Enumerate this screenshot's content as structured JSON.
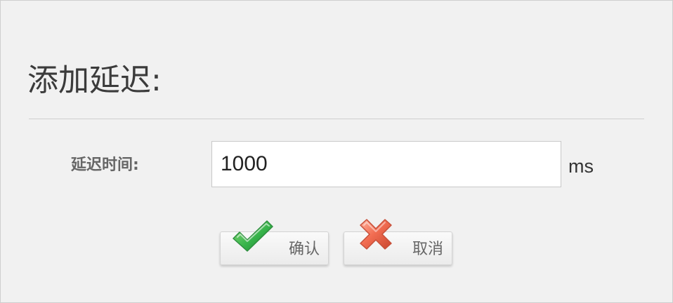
{
  "dialog": {
    "title": "添加延迟:",
    "delay_label": "延迟时间:",
    "delay_value": "1000",
    "unit": "ms",
    "confirm_label": "确认",
    "cancel_label": "取消"
  },
  "icons": {
    "confirm": "check-icon",
    "cancel": "cross-icon"
  },
  "colors": {
    "background": "#f1f1f1",
    "title": "#3b3b3b",
    "input_border": "#c8c8c8",
    "label": "#666666",
    "confirm_icon": "#39b54a",
    "cancel_icon": "#f26d52"
  }
}
